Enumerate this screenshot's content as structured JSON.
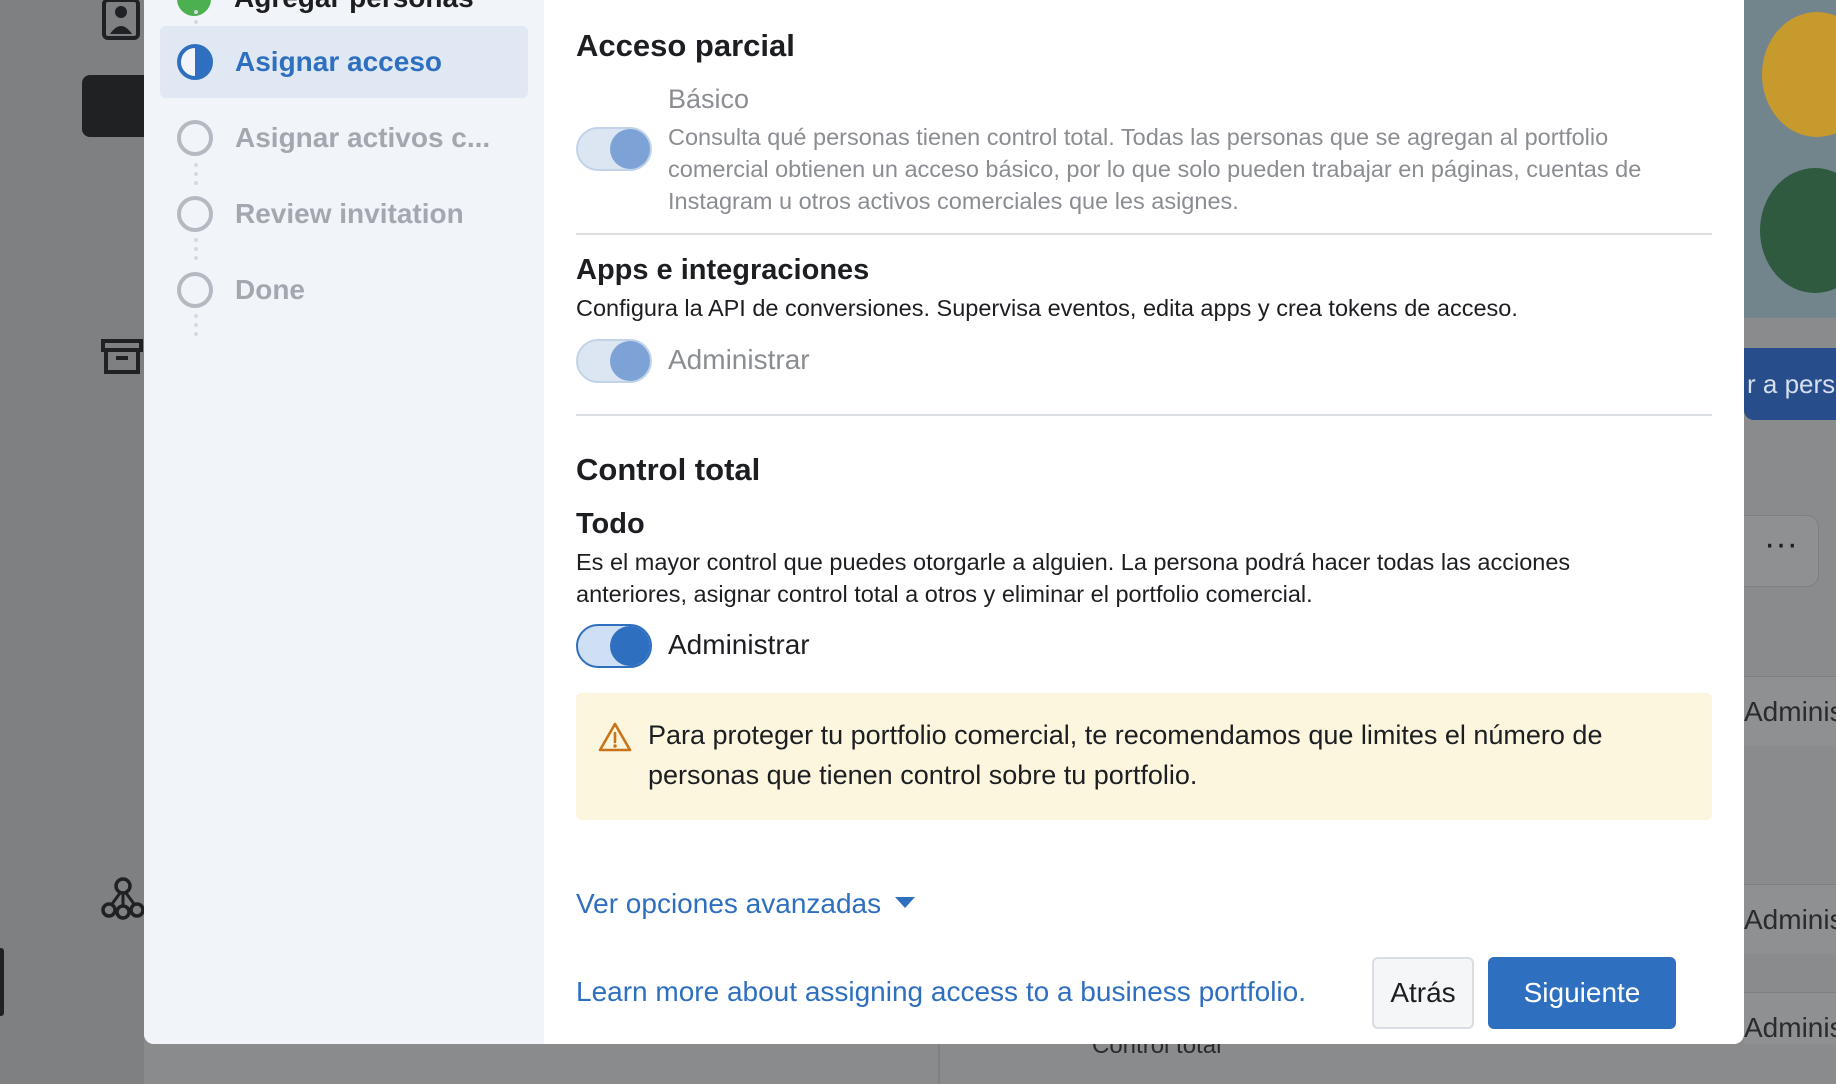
{
  "background": {
    "banner_button_text": "r a pers",
    "row_role_1": "Adminis",
    "row_role_2": "Adminis",
    "row_role_3": "Adminis",
    "bottom_role": "Control total",
    "more_options": "···"
  },
  "stepper": {
    "completed_step": "Agregar personas",
    "steps": [
      {
        "label": "Asignar acceso",
        "state": "active"
      },
      {
        "label": "Asignar activos c...",
        "state": "pending"
      },
      {
        "label": "Review invitation",
        "state": "pending"
      },
      {
        "label": "Done",
        "state": "pending"
      }
    ]
  },
  "partial_access": {
    "heading": "Acceso parcial",
    "basic": {
      "title": "Básico",
      "description": "Consulta qué personas tienen control total. Todas las personas que se agregan al portfolio comercial obtienen un acceso básico, por lo que solo pueden trabajar en páginas, cuentas de Instagram u otros activos comerciales que les asignes.",
      "enabled": true,
      "locked": true
    },
    "apps": {
      "title": "Apps e integraciones",
      "description": "Configura la API de conversiones. Supervisa eventos, edita apps y crea tokens de acceso.",
      "toggle_label": "Administrar",
      "enabled": true,
      "locked": true
    }
  },
  "full_control": {
    "heading": "Control total",
    "all": {
      "title": "Todo",
      "description": "Es el mayor control que puedes otorgarle a alguien. La persona podrá hacer todas las acciones anteriores, asignar control total a otros y eliminar el portfolio comercial.",
      "toggle_label": "Administrar",
      "enabled": true
    },
    "warning": "Para proteger tu portfolio comercial, te recomendamos que limites el número de personas que tienen control sobre tu portfolio."
  },
  "advanced_link": "Ver opciones avanzadas",
  "footer": {
    "learn_more": "Learn more about assigning access to a business portfolio.",
    "back_label": "Atrás",
    "next_label": "Siguiente"
  },
  "colors": {
    "accent": "#2f6fbf",
    "warning_bg": "#fcf6df",
    "warning_icon": "#c8731a",
    "sidebar_bg": "#f1f4f9"
  }
}
